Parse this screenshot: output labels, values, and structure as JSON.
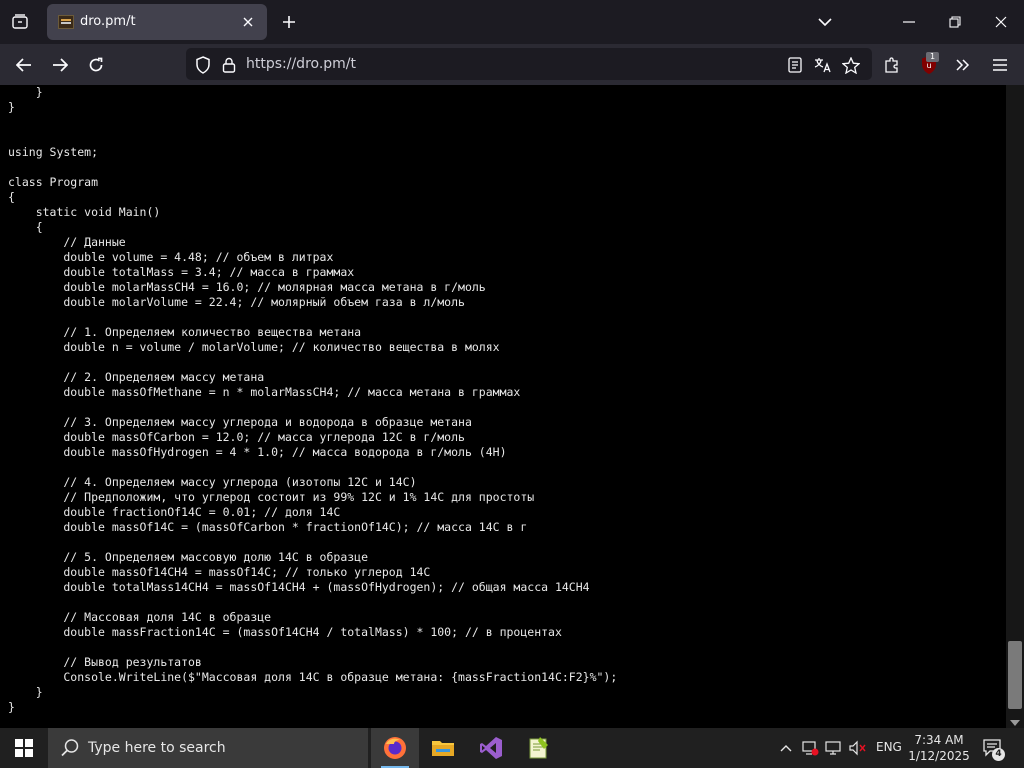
{
  "browser": {
    "tab_title": "dro.pm/t",
    "url": "https://dro.pm/t",
    "extension_badge": "1"
  },
  "code_lines": [
    "    }",
    "}",
    "",
    "",
    "using System;",
    "",
    "class Program",
    "{",
    "    static void Main()",
    "    {",
    "        // Данные",
    "        double volume = 4.48; // объем в литрах",
    "        double totalMass = 3.4; // масса в граммах",
    "        double molarMassCH4 = 16.0; // молярная масса метана в г/моль",
    "        double molarVolume = 22.4; // молярный объем газа в л/моль",
    "",
    "        // 1. Определяем количество вещества метана",
    "        double n = volume / molarVolume; // количество вещества в молях",
    "",
    "        // 2. Определяем массу метана",
    "        double massOfMethane = n * molarMassCH4; // масса метана в граммах",
    "",
    "        // 3. Определяем массу углерода и водорода в образце метана",
    "        double massOfCarbon = 12.0; // масса углерода 12C в г/моль",
    "        double massOfHydrogen = 4 * 1.0; // масса водорода в г/моль (4H)",
    "",
    "        // 4. Определяем массу углерода (изотопы 12C и 14C)",
    "        // Предположим, что углерод состоит из 99% 12C и 1% 14C для простоты",
    "        double fractionOf14C = 0.01; // доля 14C",
    "        double massOf14C = (massOfCarbon * fractionOf14C); // масса 14C в г",
    "",
    "        // 5. Определяем массовую долю 14C в образце",
    "        double massOf14CH4 = massOf14C; // только углерод 14C",
    "        double totalMass14CH4 = massOf14CH4 + (massOfHydrogen); // общая масса 14CH4",
    "",
    "        // Массовая доля 14C в образце",
    "        double massFraction14C = (massOf14CH4 / totalMass) * 100; // в процентах",
    "",
    "        // Вывод результатов",
    "        Console.WriteLine($\"Массовая доля 14C в образце метана: {massFraction14C:F2}%\");",
    "    }",
    "}"
  ],
  "taskbar": {
    "search_placeholder": "Type here to search",
    "language": "ENG",
    "time": "7:34 AM",
    "date": "1/12/2025",
    "notification_count": "4"
  },
  "scrollbar": {
    "position": 0.87
  }
}
